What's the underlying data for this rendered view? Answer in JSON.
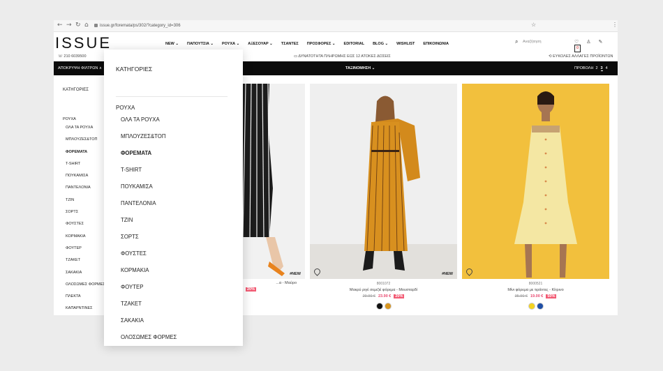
{
  "browser": {
    "url": "issue.gr/foremata/ps/302/?category_id=306",
    "nav_icons": [
      "arrow-left-icon",
      "arrow-right-icon",
      "reload-icon",
      "home-icon"
    ]
  },
  "header": {
    "logo": "ISSUE",
    "nav": [
      "NEW ⌄",
      "ΠΑΠΟΥΤΣΙΑ ⌄",
      "ΡΟΥΧΑ ⌄",
      "ΑΞΕΣΟΥΑΡ ⌄",
      "ΤΣΑΝΤΕΣ",
      "ΠΡΟΣΦΟΡΕΣ ⌄",
      "EDITORIAL",
      "BLOG ⌄",
      "WISHLIST",
      "ΕΠΙΚΟΙΝΩΝΙΑ"
    ],
    "search_placeholder": "Αναζήτηση",
    "cart_count": "0"
  },
  "infobar": {
    "phone": "210 6039500",
    "payment": "ΔΥΝΑΤΟΤΗΤΑ ΠΛΗΡΩΜΗΣ ΕΩΣ 12 ΑΤΟΚΕΣ ΔΟΣΕΙΣ",
    "returns": "ΕΥΚΟΛΕΣ ΑΛΛΑΓΕΣ ΠΡΟΪΟΝΤΩΝ"
  },
  "toolbar": {
    "hide_filters": "ΑΠΟΚΡΥΨΗ ΦΙΛΤΡΩΝ ∧",
    "sort": "ΤΑΞΙΝΟΜΗΣΗ ⌄",
    "view_label": "ΠΡΟΒΟΛΗ",
    "view_options": [
      "2",
      "3",
      "4"
    ],
    "view_selected": "3"
  },
  "sidebar": {
    "categories_title": "ΚΑΤΗΓΟΡΙΕΣ",
    "group": "ΡΟΥΧΑ",
    "items": [
      "ΟΛΑ ΤΑ ΡΟΥΧΑ",
      "ΜΠΛΟΥΖΕΣ&ΤΟΠ",
      "ΦΟΡΕΜΑΤΑ",
      "T-SHIRT",
      "ΠΟΥΚΑΜΙΣΑ",
      "ΠΑΝΤΕΛΟΝΙΑ",
      "ΤΖΙΝ",
      "ΣΟΡΤΣ",
      "ΦΟΥΣΤΕΣ",
      "ΚΟΡΜΑΚΙΑ",
      "ΦΟΥΤΕΡ",
      "ΤΖΑΚΕΤ",
      "ΣΑΚΑΚΙΑ",
      "ΟΛΟΣΩΜΕΣ ΦΟΡΜΕΣ",
      "ΠΛΕΚΤΑ",
      "ΚΑΠΑΡΝΤΙΝΕΣ"
    ],
    "active": "ΦΟΡΕΜΑΤΑ"
  },
  "dropdown": {
    "title": "ΚΑΤΗΓΟΡΙΕΣ",
    "group": "ΡΟΥΧΑ",
    "items": [
      "ΟΛΑ ΤΑ ΡΟΥΧΑ",
      "ΜΠΛΟΥΖΕΣ&ΤΟΠ",
      "ΦΟΡΕΜΑΤΑ",
      "T-SHIRT",
      "ΠΟΥΚΑΜΙΣΑ",
      "ΠΑΝΤΕΛΟΝΙΑ",
      "ΤΖΙΝ",
      "ΣΟΡΤΣ",
      "ΦΟΥΣΤΕΣ",
      "ΚΟΡΜΑΚΙΑ",
      "ΦΟΥΤΕΡ",
      "ΤΖΑΚΕΤ",
      "ΣΑΚΑΚΙΑ",
      "ΟΛΟΣΩΜΕΣ ΦΟΡΜΕΣ"
    ],
    "active": "ΦΟΡΕΜΑΤΑ"
  },
  "products": [
    {
      "code": "",
      "name": "...α - Μαύρο",
      "old_price": "",
      "new_price": "",
      "discount": "20%",
      "tag": "#NEW",
      "bg": "#f1f1f1",
      "swatches": []
    },
    {
      "code": "8001072",
      "name": "Μακρύ ριγέ σεμιζιέ φόρεμα - Μουσταρδί",
      "old_price": "29.90 €",
      "new_price": "23.90 €",
      "discount": "20%",
      "tag": "#NEW",
      "bg": "#efefef",
      "swatches": [
        "#111111",
        "#d9961f"
      ]
    },
    {
      "code": "8000521",
      "name": "Μίνι φόρεμα με τιράντες - Κίτρινο",
      "old_price": "35.90 €",
      "new_price": "19.00 €",
      "discount": "50%",
      "tag": "",
      "bg": "#f2c03d",
      "swatches": [
        "#f4d31f",
        "#1f4fa6"
      ]
    }
  ]
}
